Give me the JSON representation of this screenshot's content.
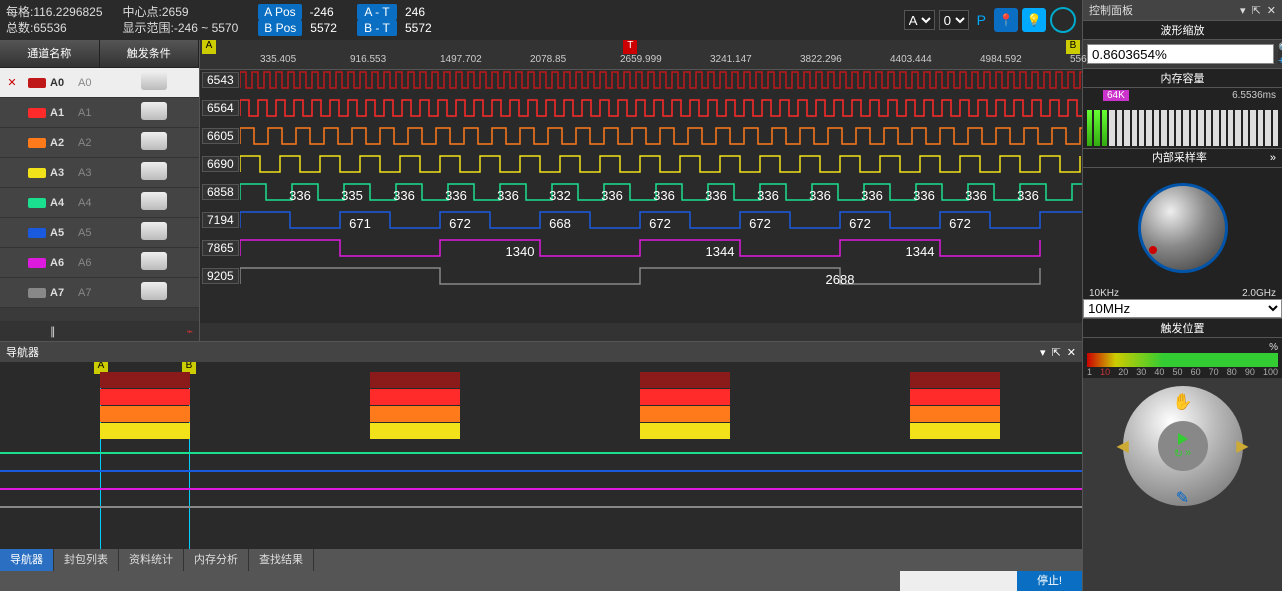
{
  "topbar": {
    "per_grid_label": "每格:",
    "per_grid_value": "116.2296825",
    "total_label": "总数:",
    "total_value": "65536",
    "center_label": "中心点:",
    "center_value": "2659",
    "range_label": "显示范围:",
    "range_value": "-246 ~ 5570",
    "a_pos_label": "A Pos",
    "a_pos_value": "-246",
    "b_pos_label": "B Pos",
    "b_pos_value": "5572",
    "a_t_label": "A - T",
    "a_t_value": "246",
    "b_t_label": "B - T",
    "b_t_value": "5572",
    "sel_a": "A",
    "sel_0": "0"
  },
  "channels_header": {
    "name": "通道名称",
    "trigger": "触发条件"
  },
  "channels": [
    {
      "id": "A0",
      "alias": "A0",
      "color": "#c01818",
      "selected": true
    },
    {
      "id": "A1",
      "alias": "A1",
      "color": "#ff2a2a",
      "selected": false
    },
    {
      "id": "A2",
      "alias": "A2",
      "color": "#ff7a1a",
      "selected": false
    },
    {
      "id": "A3",
      "alias": "A3",
      "color": "#f2e21a",
      "selected": false
    },
    {
      "id": "A4",
      "alias": "A4",
      "color": "#1adf8f",
      "selected": false
    },
    {
      "id": "A5",
      "alias": "A5",
      "color": "#1a5adf",
      "selected": false
    },
    {
      "id": "A6",
      "alias": "A6",
      "color": "#df1adf",
      "selected": false
    },
    {
      "id": "A7",
      "alias": "A7",
      "color": "#888888",
      "selected": false
    }
  ],
  "ruler_ticks": [
    "335.405",
    "916.553",
    "1497.702",
    "2078.85",
    "2659.999",
    "3241.147",
    "3822.296",
    "4403.444",
    "4984.592",
    "556"
  ],
  "ruler_markers": {
    "A": "A",
    "B": "B",
    "T": "T"
  },
  "wave_labels": [
    "6543",
    "6564",
    "6605",
    "6690",
    "6858",
    "7194",
    "7865",
    "9205"
  ],
  "seg_row4": [
    "336",
    "335",
    "336",
    "336",
    "336",
    "332",
    "336",
    "336",
    "336",
    "336",
    "336",
    "336",
    "336",
    "336",
    "336"
  ],
  "seg_row5": [
    "671",
    "672",
    "668",
    "672",
    "672",
    "672",
    "672"
  ],
  "seg_row6": [
    "1340",
    "1344",
    "1344"
  ],
  "seg_row7": [
    "2688"
  ],
  "navigator": {
    "title": "导航器",
    "cursor_a": "A",
    "cursor_b": "B",
    "tabs": [
      "导航器",
      "封包列表",
      "资料统计",
      "内存分析",
      "查找结果"
    ],
    "active_tab": 0
  },
  "status": {
    "stop": "停止!"
  },
  "control_panel": {
    "title": "控制面板",
    "zoom_section": "波形缩放",
    "zoom_value": "0.8603654%",
    "mem_section": "内存容量",
    "mem_badge": "64K",
    "mem_time": "6.5536ms",
    "mem_used": 3,
    "mem_total": 26,
    "rate_section": "内部采样率",
    "freq_min": "10KHz",
    "freq_max": "2.0GHz",
    "freq_sel": "10MHz",
    "trig_section": "触发位置",
    "trig_pct": "%",
    "trig_scale": [
      "1",
      "10",
      "20",
      "30",
      "40",
      "50",
      "60",
      "70",
      "80",
      "90",
      "100"
    ]
  }
}
